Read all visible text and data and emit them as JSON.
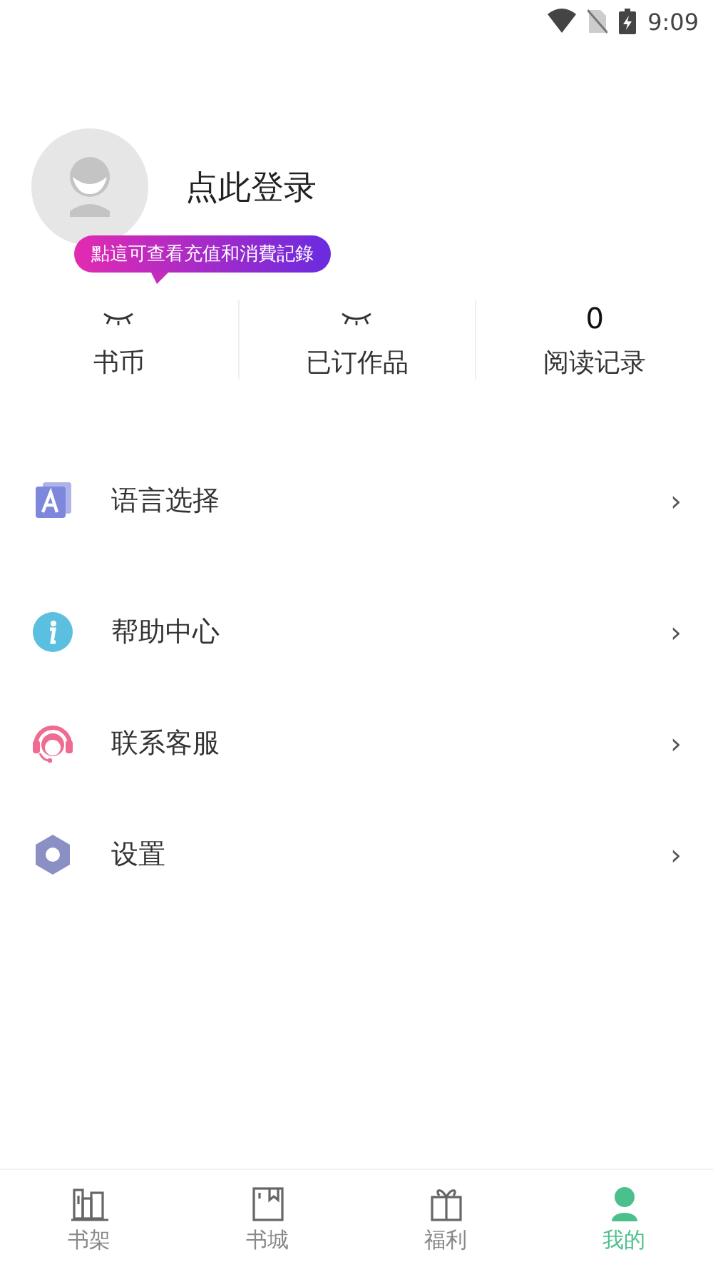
{
  "status_bar": {
    "time": "9:09"
  },
  "profile": {
    "login_label": "点此登录",
    "tooltip": "點這可查看充值和消費記錄"
  },
  "stats": [
    {
      "label": "书币",
      "masked": true
    },
    {
      "label": "已订作品",
      "masked": true
    },
    {
      "label": "阅读记录",
      "masked": false,
      "value": "0"
    }
  ],
  "menu": [
    {
      "kind": "language",
      "label": "语言选择",
      "chevron": "›"
    },
    {
      "kind": "help",
      "label": "帮助中心",
      "chevron": "›"
    },
    {
      "kind": "service",
      "label": "联系客服",
      "chevron": "›"
    },
    {
      "kind": "settings",
      "label": "设置",
      "chevron": "›"
    }
  ],
  "tabs": [
    {
      "kind": "shelf",
      "label": "书架",
      "selected": false
    },
    {
      "kind": "store",
      "label": "书城",
      "selected": false
    },
    {
      "kind": "gift",
      "label": "福利",
      "selected": false
    },
    {
      "kind": "me",
      "label": "我的",
      "selected": true
    }
  ]
}
